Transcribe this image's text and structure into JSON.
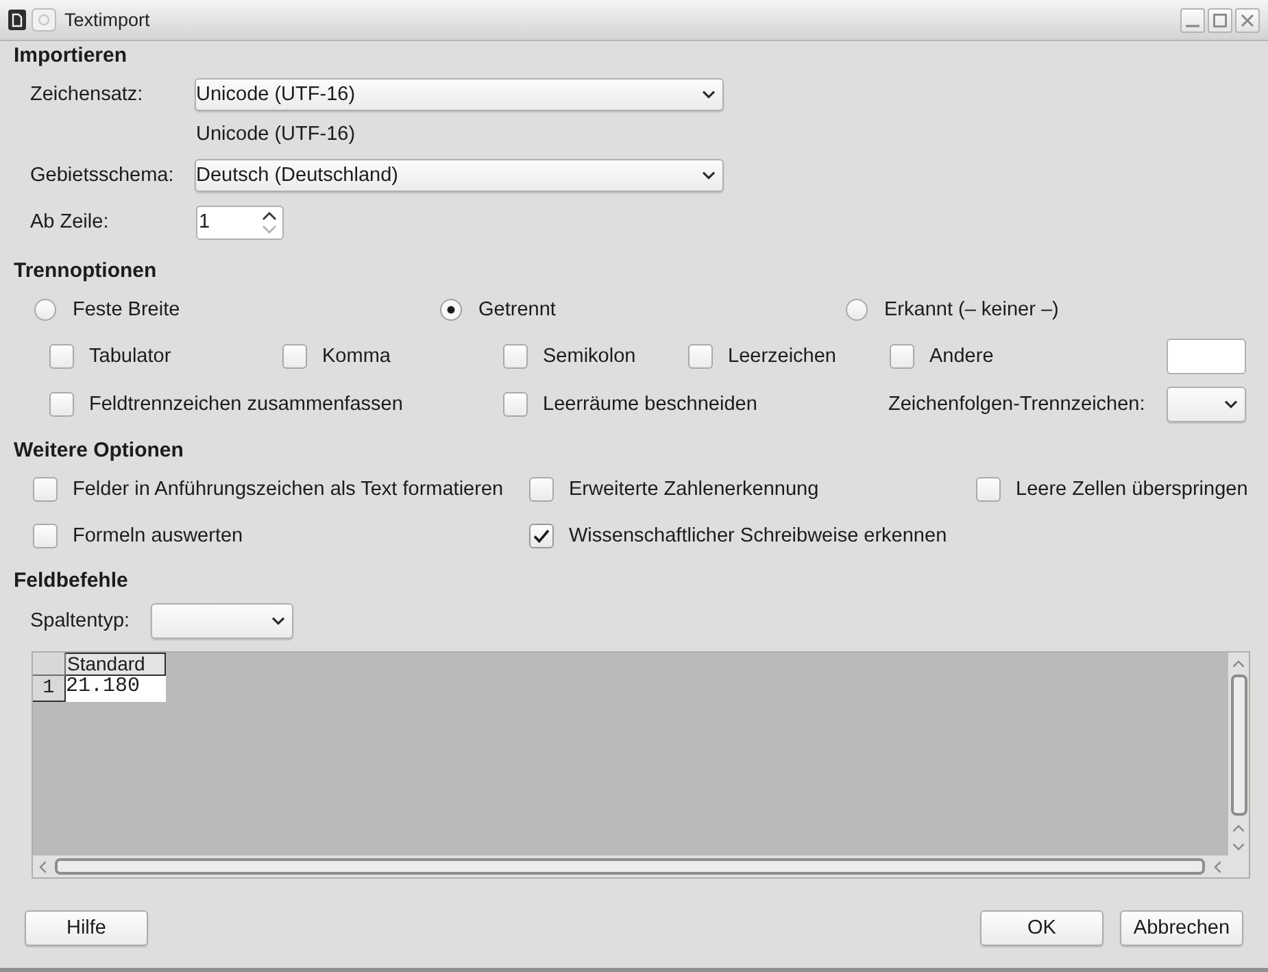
{
  "window": {
    "title": "Textimport"
  },
  "import": {
    "heading": "Importieren",
    "charset": {
      "label": "Zeichensatz:",
      "value": "Unicode (UTF-16)",
      "info": "Unicode (UTF-16)"
    },
    "locale": {
      "label": "Gebietsschema:",
      "value": "Deutsch (Deutschland)"
    },
    "start_row": {
      "label": "Ab Zeile:",
      "value": "1",
      "decrement_disabled": true
    }
  },
  "separator_options": {
    "heading": "Trennoptionen",
    "modes": [
      {
        "label": "Feste Breite",
        "selected": false
      },
      {
        "label": "Getrennt",
        "selected": true
      },
      {
        "label": "Erkannt (– keiner –)",
        "selected": false
      }
    ],
    "separators": [
      {
        "label": "Tabulator",
        "checked": false
      },
      {
        "label": "Komma",
        "checked": false
      },
      {
        "label": "Semikolon",
        "checked": false
      },
      {
        "label": "Leerzeichen",
        "checked": false
      },
      {
        "label": "Andere",
        "checked": false
      }
    ],
    "merge_delimiters": {
      "label": "Feldtrennzeichen zusammenfassen",
      "checked": false
    },
    "trim_spaces": {
      "label": "Leerräume beschneiden",
      "checked": false
    },
    "string_delimiter": {
      "label": "Zeichenfolgen-Trennzeichen:"
    }
  },
  "other_options": {
    "heading": "Weitere Optionen",
    "options": [
      {
        "label": "Felder in Anführungszeichen als Text formatieren",
        "checked": false
      },
      {
        "label": "Erweiterte Zahlenerkennung",
        "checked": false
      },
      {
        "label": "Leere Zellen überspringen",
        "checked": false
      },
      {
        "label": "Formeln auswerten",
        "checked": false
      },
      {
        "label": "Wissenschaftlicher Schreibweise erkennen",
        "checked": true
      }
    ]
  },
  "field_options": {
    "heading": "Feldbefehle",
    "column_type": {
      "label": "Spaltentyp:"
    },
    "preview": {
      "columns": [
        "Standard"
      ],
      "rows": [
        {
          "header": "1",
          "cells": [
            "21.180"
          ]
        }
      ]
    }
  },
  "buttons": [
    {
      "label": "Hilfe",
      "kind": "help"
    },
    {
      "label": "OK",
      "kind": "ok"
    },
    {
      "label": "Abbrechen",
      "kind": "cancel"
    }
  ]
}
